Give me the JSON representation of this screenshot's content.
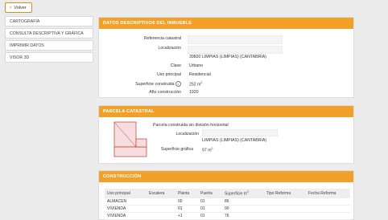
{
  "back_button": {
    "label": "Volver"
  },
  "sidebar": {
    "items": [
      {
        "label": "CARTOGRAFÍA"
      },
      {
        "label": "CONSULTA DESCRIPTIVA Y GRÁFICA"
      },
      {
        "label": "IMPRIMIR DATOS"
      },
      {
        "label": "VISOR 3D"
      }
    ]
  },
  "datos": {
    "title": "DATOS DESCRIPTIVOS DEL INMUEBLE",
    "referencia_label": "Referencia catastral",
    "localizacion_label": "Localización",
    "localizacion_value": "39820 LIMPIAS (LIMPIAS) (CANTABRIA)",
    "clase_label": "Clase",
    "clase_value": "Urbano",
    "uso_label": "Uso principal",
    "uso_value": "Residencial",
    "superficie_label": "Superficie construida",
    "superficie_value": "252 m",
    "superficie_unit_sup": "2",
    "anio_label": "Año construcción",
    "anio_value": "1920"
  },
  "parcela": {
    "title": "PARCELA CATASTRAL",
    "descripcion": "Parcela construida sin división horizontal",
    "localizacion_label": "Localización",
    "localizacion_value": "LIMPIAS (LIMPIAS) (CANTABRIA)",
    "superficie_label": "Superficie gráfica",
    "superficie_value": "97 m",
    "superficie_unit_sup": "2"
  },
  "construccion": {
    "title": "CONSTRUCCIÓN",
    "columns": [
      "Uso principal",
      "Escalera",
      "Planta",
      "Puerta",
      "Superficie m",
      "Tipo Reforma",
      "Fecha Reforma"
    ],
    "superficie_col_sup": "2",
    "rows": [
      [
        "ALMACEN",
        "",
        "00",
        "01",
        "86",
        "",
        ""
      ],
      [
        "VIVIENDA",
        "",
        "01",
        "01",
        "90",
        "",
        ""
      ],
      [
        "VIVIENDA",
        "",
        "+1",
        "01",
        "76",
        "",
        ""
      ]
    ]
  },
  "colors": {
    "accent": "#f1a02a",
    "button_border": "#e08a1e",
    "parcel_stroke": "#c0392b",
    "parcel_fill": "#f7dede"
  }
}
